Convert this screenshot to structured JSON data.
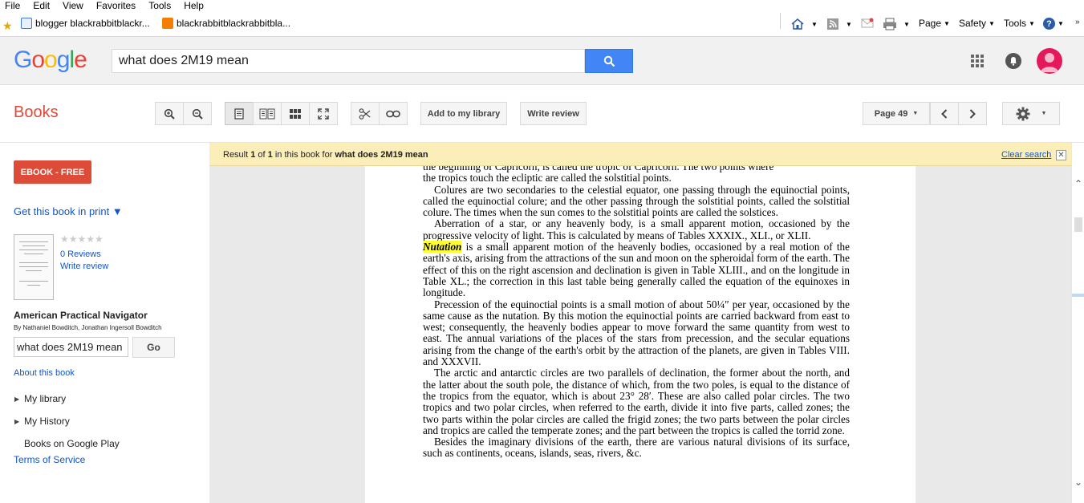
{
  "browser": {
    "menu": [
      "File",
      "Edit",
      "View",
      "Favorites",
      "Tools",
      "Help"
    ],
    "favorites": [
      {
        "label": "blogger blackrabbitblackr...",
        "icon": "ie-page-icon"
      },
      {
        "label": "blackrabbitblackrabbitbla...",
        "icon": "blogger-icon"
      }
    ],
    "tools": {
      "page": "Page",
      "safety": "Safety",
      "tools": "Tools"
    }
  },
  "header": {
    "logo": "Google",
    "search_value": "what does 2M19 mean"
  },
  "toolbar": {
    "title": "Books",
    "add_library": "Add to my library",
    "write_review": "Write review",
    "page_label": "Page 49"
  },
  "sidebar": {
    "ebook_btn": "EBOOK - FREE",
    "get_book": "Get this book in print ▼",
    "stars": "★★★★★",
    "reviews": "0 Reviews",
    "write_review": "Write review",
    "book_title": "American Practical Navigator",
    "authors": "By Nathaniel Bowditch, Jonathan Ingersoll Bowditch",
    "search_value": "what does 2M19 mean",
    "go": "Go",
    "about": "About this book",
    "nav": [
      "My library",
      "My History"
    ],
    "play": "Books on Google Play",
    "tos": "Terms of Service"
  },
  "result": {
    "prefix": "Result ",
    "index": "1",
    "of": " of ",
    "total": "1",
    "mid": " in this book for ",
    "query": "what does 2M19 mean",
    "clear": "Clear search",
    "close": "✕"
  },
  "page_content": {
    "line0": "the beginning of Capricorn, is called the tropic of Capricorn. The two points where",
    "line1": "the tropics touch the ecliptic are called the solstitial points.",
    "p_colures": "Colures are two secondaries to the celestial equator, one passing through the equinoctial points, called the equinoctial colure; and the other passing through the solstitial points, called the solstitial colure. The times when the sun comes to the solstitial points are called the solstices.",
    "p_aberration": "Aberration of a star, or any heavenly body, is a small apparent motion, occasioned by the progressive velocity of light. This is calculated by means of Tables XXXIX., XLI., or XLII.",
    "nutation_term": "Nutation",
    "p_nutation_rest": " is a small apparent motion of the heavenly bodies, occasioned by a real motion of the earth's axis, arising from the attractions of the sun and moon on the spheroidal form of the earth. The effect of this on the right ascension and declination is given in Table XLIII., and on the longitude in Table XL.; the correction in this last table being generally called the equation of the equinoxes in longitude.",
    "p_precession": "Precession of the equinoctial points is a small motion of about 50¼″ per year, occasioned by the same cause as the nutation. By this motion the equinoctial points are carried backward from east to west; consequently, the heavenly bodies appear to move forward the same quantity from west to east. The annual variations of the places of the stars from precession, and the secular equations arising from the change of the earth's orbit by the attraction of the planets, are given in Tables VIII. and XXXVII.",
    "p_arctic": "The arctic and antarctic circles are two parallels of declination, the former about the north, and the latter about the south pole, the distance of which, from the two poles, is equal to the distance of the tropics from the equator, which is about 23° 28′. These are also called polar circles. The two tropics and two polar circles, when referred to the earth, divide it into five parts, called zones; the two parts within the polar circles are called the frigid zones; the two parts between the polar circles and tropics are called the temperate zones; and the part between the tropics is called the torrid zone.",
    "p_besides": "Besides the imaginary divisions of the earth, there are various natural divisions of its surface, such as continents, oceans, islands, seas, rivers, &c."
  },
  "colors": {
    "google_blue": "#4285f4",
    "books_red": "#dd4b39",
    "highlight": "#ffff33",
    "result_bar": "#fbeeb8",
    "link": "#1155cc"
  }
}
